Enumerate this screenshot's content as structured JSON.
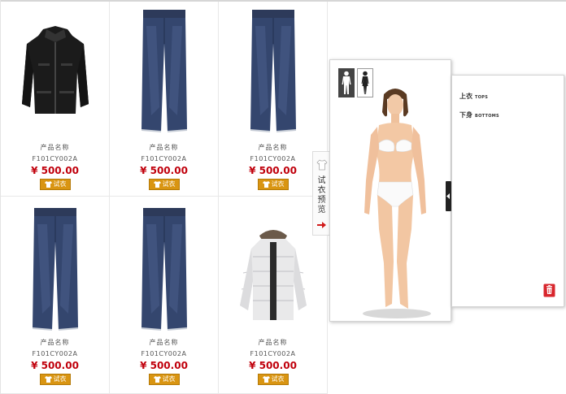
{
  "products": [
    {
      "name": "产品名称",
      "code": "F101CY002A",
      "price": "¥ 500.00",
      "try_label": "试衣",
      "image": "black-jacket"
    },
    {
      "name": "产品名称",
      "code": "F101CY002A",
      "price": "¥ 500.00",
      "try_label": "试衣",
      "image": "jeans"
    },
    {
      "name": "产品名称",
      "code": "F101CY002A",
      "price": "¥ 500.00",
      "try_label": "试衣",
      "image": "jeans"
    },
    {
      "name": "产品名称",
      "code": "F101CY002A",
      "price": "¥ 500.00",
      "try_label": "试衣",
      "image": "jeans"
    },
    {
      "name": "产品名称",
      "code": "F101CY002A",
      "price": "¥ 500.00",
      "try_label": "试衣",
      "image": "jeans"
    },
    {
      "name": "产品名称",
      "code": "F101CY002A",
      "price": "¥ 500.00",
      "try_label": "试衣",
      "image": "white-down-jacket"
    }
  ],
  "side_tab": {
    "label": "试衣预览",
    "icon": "shirt-icon",
    "arrow_icon": "arrow-right-icon"
  },
  "fitting": {
    "model_options": [
      "male-model-icon",
      "female-model-icon"
    ],
    "active_model": "female"
  },
  "categories": [
    {
      "cn": "上衣",
      "en": "TOPS"
    },
    {
      "cn": "下身",
      "en": "BOTTOMS"
    }
  ],
  "colors": {
    "price": "#c0000c",
    "button": "#d99512",
    "trash": "#d8262d"
  }
}
